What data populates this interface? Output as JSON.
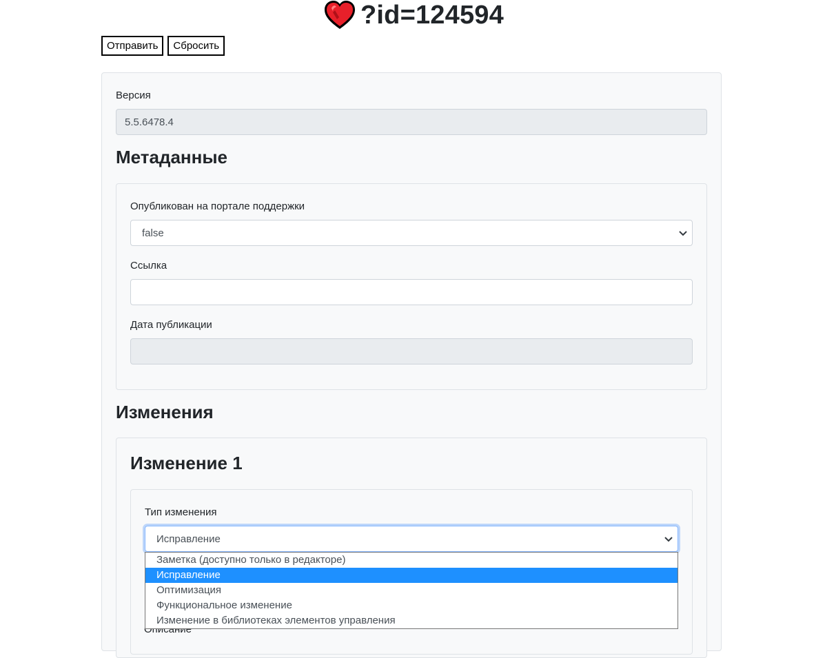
{
  "header": {
    "title": "?id=124594",
    "icon": "heart-icon"
  },
  "toolbar": {
    "submit_label": "Отправить",
    "reset_label": "Сбросить"
  },
  "version": {
    "label": "Версия",
    "value": "5.5.6478.4"
  },
  "metadata": {
    "heading": "Метаданные",
    "published_label": "Опубликован на портале поддержки",
    "published_value": "false",
    "link_label": "Ссылка",
    "link_value": "",
    "publication_date_label": "Дата публикации",
    "publication_date_value": ""
  },
  "changes": {
    "heading": "Изменения",
    "items": [
      {
        "heading": "Изменение 1",
        "type_label": "Тип изменения",
        "type_value": "Исправление",
        "type_options": [
          "Заметка (доступно только в редакторе)",
          "Исправление",
          "Оптимизация",
          "Функциональное изменение",
          "Изменение в библиотеках элементов управления"
        ],
        "selected_option_index": 1,
        "description_label": "Описание"
      }
    ]
  },
  "colors": {
    "panel_background": "#f8f9fa",
    "border": "#dee2e6",
    "disabled_input": "#e9ecef",
    "dropdown_highlight": "#1e90ff",
    "heart": "#e8202a"
  }
}
